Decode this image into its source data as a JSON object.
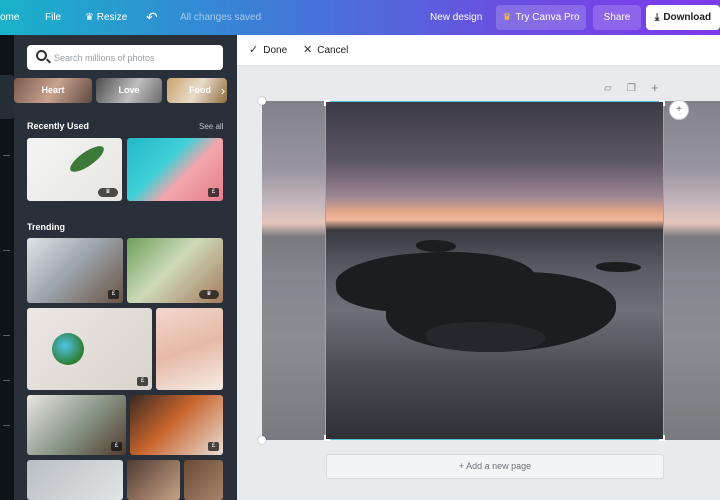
{
  "topbar": {
    "home": "ome",
    "file": "File",
    "resize": "Resize",
    "resize_icon": "crown-icon",
    "undo_icon": "undo-icon",
    "saved_status": "All changes saved",
    "new_design": "New design",
    "try_pro": "Try Canva Pro",
    "share": "Share",
    "download": "Download",
    "download_icon": "download-icon"
  },
  "panel": {
    "search_placeholder": "Search millions of photos",
    "categories": [
      "Heart",
      "Love",
      "Food"
    ],
    "recently_used_title": "Recently Used",
    "see_all": "See all",
    "trending_title": "Trending",
    "badges": {
      "crown": "♛",
      "pound": "£"
    }
  },
  "editor": {
    "done": "Done",
    "cancel": "Cancel",
    "add_page": "+ Add a new page"
  },
  "colors": {
    "topbar_gradient_start": "#19b2c9",
    "topbar_gradient_end": "#7c3aed",
    "panel_bg": "#293039",
    "selection": "#49c5d4"
  }
}
